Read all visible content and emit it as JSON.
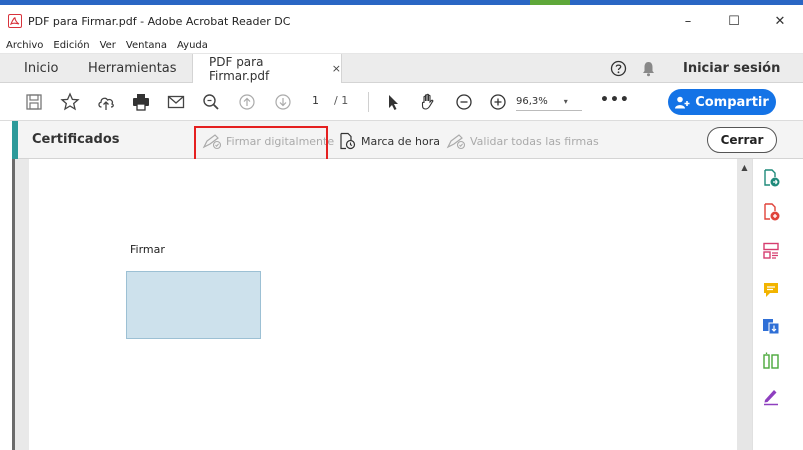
{
  "window": {
    "title": "PDF para Firmar.pdf - Adobe Acrobat Reader DC",
    "minimize_glyph": "–",
    "maximize_glyph": "☐",
    "close_glyph": "✕"
  },
  "menu": [
    "Archivo",
    "Edición",
    "Ver",
    "Ventana",
    "Ayuda"
  ],
  "tabs": {
    "home": "Inicio",
    "tools": "Herramientas",
    "document": "PDF para Firmar.pdf",
    "close_glyph": "×",
    "signin": "Iniciar sesión"
  },
  "toolbar": {
    "page_current": "1",
    "page_total": "/ 1",
    "zoom": "96,3%",
    "zoom_caret": "▾",
    "more": "•••",
    "share": "Compartir"
  },
  "certificates": {
    "title": "Certificados",
    "sign_digitally": "Firmar digitalmente",
    "timestamp": "Marca de hora",
    "validate_all": "Validar todas las firmas",
    "close": "Cerrar"
  },
  "document": {
    "field_label": "Firmar"
  },
  "scrollbar": {
    "up_glyph": "▲"
  },
  "colors": {
    "accent_blue": "#1473e6",
    "highlight_red": "#e52020",
    "cert_accent": "#2d9a9a",
    "signature_field": "#cde1ec"
  },
  "icons": {
    "toolbar": [
      "save-icon",
      "bookmark-star-icon",
      "upload-cloud-icon",
      "print-icon",
      "email-icon",
      "zoom-search-icon",
      "page-up-icon",
      "page-down-icon",
      "select-cursor-icon",
      "hand-tool-icon",
      "zoom-out-icon",
      "zoom-in-icon"
    ],
    "right_rail": [
      "export-pdf-icon",
      "create-pdf-icon",
      "edit-pdf-icon",
      "comment-icon",
      "combine-files-icon",
      "organize-pages-icon",
      "fill-sign-icon"
    ]
  }
}
